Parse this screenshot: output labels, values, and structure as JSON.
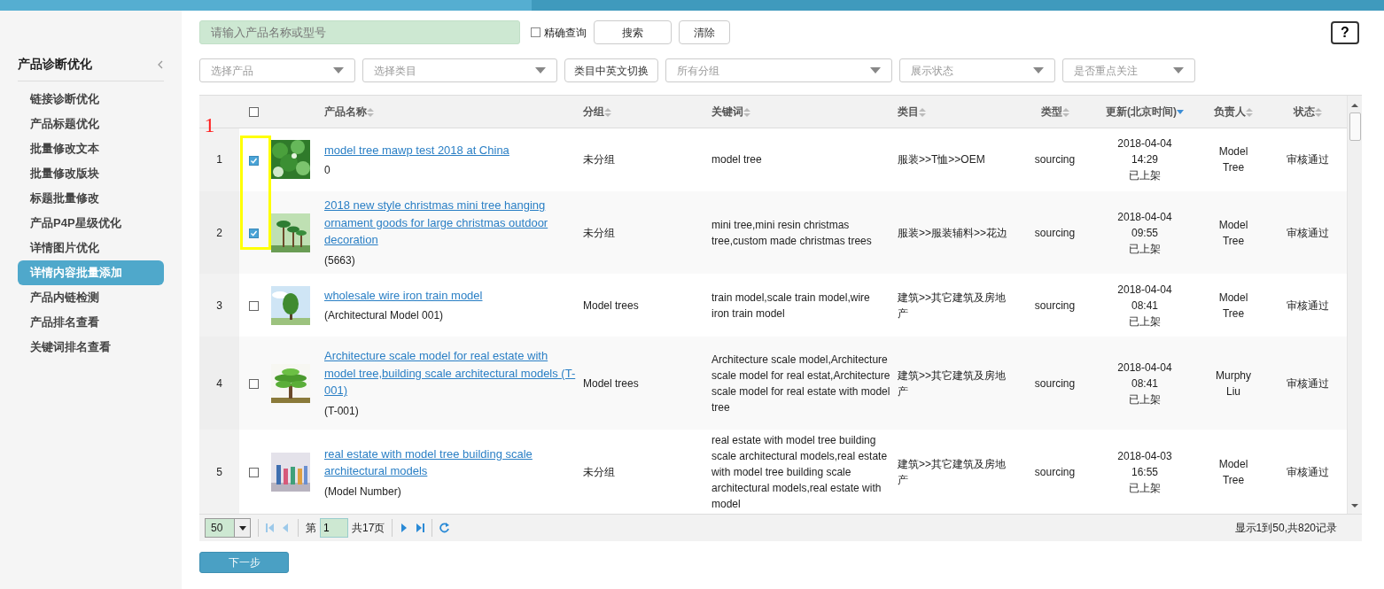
{
  "sidebar": {
    "title": "产品诊断优化",
    "items": [
      {
        "label": "链接诊断优化",
        "selected": false
      },
      {
        "label": "产品标题优化",
        "selected": false
      },
      {
        "label": "批量修改文本",
        "selected": false
      },
      {
        "label": "批量修改版块",
        "selected": false
      },
      {
        "label": "标题批量修改",
        "selected": false
      },
      {
        "label": "产品P4P星级优化",
        "selected": false
      },
      {
        "label": "详情图片优化",
        "selected": false
      },
      {
        "label": "详情内容批量添加",
        "selected": true
      },
      {
        "label": "产品内链检测",
        "selected": false
      },
      {
        "label": "产品排名查看",
        "selected": false
      },
      {
        "label": "关键词排名查看",
        "selected": false
      }
    ]
  },
  "search": {
    "placeholder": "请输入产品名称或型号",
    "exact_label": "精确查询",
    "exact_checked": false,
    "buttons": [
      "搜索",
      "清除"
    ]
  },
  "help": "?",
  "filters": [
    {
      "kind": "select",
      "placeholder": "选择产品"
    },
    {
      "kind": "select",
      "placeholder": "选择类目"
    },
    {
      "kind": "button",
      "label": "类目中英文切换"
    },
    {
      "kind": "select",
      "placeholder": "所有分组"
    },
    {
      "kind": "select",
      "placeholder": "展示状态"
    },
    {
      "kind": "select",
      "placeholder": "是否重点关注"
    }
  ],
  "table": {
    "all_checked": false,
    "columns": [
      {
        "label": "产品名称",
        "sorted": false
      },
      {
        "label": "分组",
        "sorted": false
      },
      {
        "label": "关键词",
        "sorted": false
      },
      {
        "label": "类目",
        "sorted": false
      },
      {
        "label": "类型",
        "sorted": false
      },
      {
        "label": "更新(北京时间)",
        "sorted": true
      },
      {
        "label": "负责人",
        "sorted": false
      },
      {
        "label": "状态",
        "sorted": false
      }
    ],
    "rows": [
      {
        "index": "1",
        "checked": true,
        "name": "model tree mawp test 2018 at China",
        "model": "0",
        "group": "未分组",
        "keywords": "model tree",
        "category": "服装>>T恤>>OEM",
        "type": "sourcing",
        "date": "2018-04-04",
        "time": "14:29",
        "listing": "已上架",
        "owner": "Model Tree",
        "status": "审核通过"
      },
      {
        "index": "2",
        "checked": true,
        "name": "2018 new style christmas mini tree hanging ornament goods for large christmas outdoor decoration",
        "model": "(5663)",
        "group": "未分组",
        "keywords": "mini tree,mini resin christmas tree,custom made christmas trees",
        "category": "服装>>服装辅料>>花边",
        "type": "sourcing",
        "date": "2018-04-04",
        "time": "09:55",
        "listing": "已上架",
        "owner": "Model Tree",
        "status": "审核通过"
      },
      {
        "index": "3",
        "checked": false,
        "name": "wholesale wire iron train model",
        "model": "(Architectural Model 001)",
        "group": "Model trees",
        "keywords": "train model,scale train model,wire iron train model",
        "category": "建筑>>其它建筑及房地产",
        "type": "sourcing",
        "date": "2018-04-04",
        "time": "08:41",
        "listing": "已上架",
        "owner": "Model Tree",
        "status": "审核通过"
      },
      {
        "index": "4",
        "checked": false,
        "name": "Architecture scale model for real estate with model tree,building scale architectural models (T-001)",
        "model": "(T-001)",
        "group": "Model trees",
        "keywords": "Architecture scale model,Architecture scale model for real estat,Architecture scale model for real estate with model tree",
        "category": "建筑>>其它建筑及房地产",
        "type": "sourcing",
        "date": "2018-04-04",
        "time": "08:41",
        "listing": "已上架",
        "owner": "Murphy Liu",
        "status": "审核通过"
      },
      {
        "index": "5",
        "checked": false,
        "name": "real estate with model tree building scale architectural models",
        "model": "(Model Number)",
        "group": "未分组",
        "keywords": "real estate with model tree building scale architectural models,real estate with model tree building scale architectural models,real estate with model",
        "category": "建筑>>其它建筑及房地产",
        "type": "sourcing",
        "date": "2018-04-03",
        "time": "16:55",
        "listing": "已上架",
        "owner": "Model Tree",
        "status": "审核通过"
      }
    ]
  },
  "pager": {
    "page_size": "50",
    "page_prefix": "第",
    "page": "1",
    "page_total": "共17页",
    "summary": "显示1到50,共820记录"
  },
  "annotation": {
    "label": "1"
  },
  "next_button": "下一步"
}
